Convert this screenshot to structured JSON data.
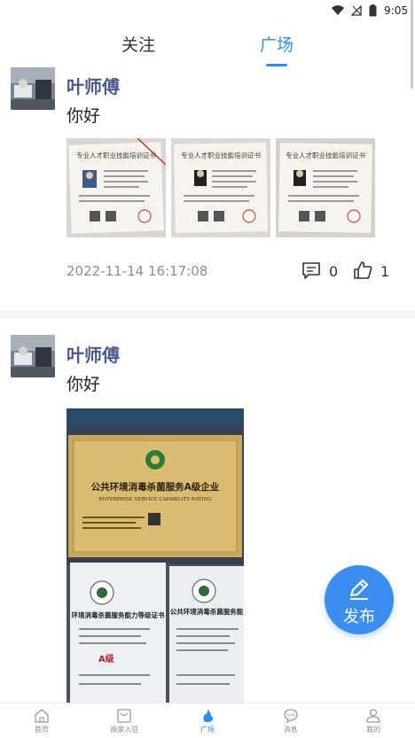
{
  "status_bar": {
    "time": "9:05"
  },
  "tabs": {
    "follow": "关注",
    "square": "广场"
  },
  "posts": [
    {
      "author": "叶师傅",
      "content": "你好",
      "time": "2022-11-14 16:17:08",
      "comments": "0",
      "likes": "1",
      "certificate_title": "专业人才职业技能培训证书"
    },
    {
      "author": "叶师傅",
      "content": "你好",
      "certificate": {
        "title": "公共环境消毒杀菌服务A级企业",
        "subtitle": "ENTERPRISE SERVICE CAPABILITY RATING",
        "cert_left_title": "环境消毒杀菌服务能力等级证书",
        "cert_right_title": "公共环境消毒杀菌服务能",
        "grade": "A级"
      }
    }
  ],
  "fab": {
    "label": "发布"
  },
  "bottom_nav": {
    "items": [
      {
        "label": "首页",
        "icon": "home-icon"
      },
      {
        "label": "商家入驻",
        "icon": "shop-icon"
      },
      {
        "label": "广场",
        "icon": "square-icon"
      },
      {
        "label": "消息",
        "icon": "message-icon"
      },
      {
        "label": "我的",
        "icon": "profile-icon"
      }
    ]
  },
  "colors": {
    "accent": "#2c8ff0",
    "author": "#4a5a8c",
    "fab": "#3b8ef0"
  }
}
